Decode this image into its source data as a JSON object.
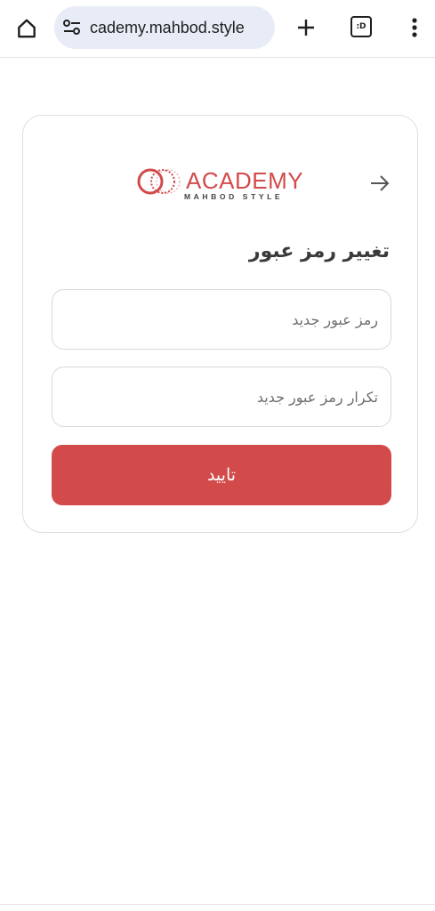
{
  "browser": {
    "url": "academy.mahbod.style",
    "url_visible": "cademy.mahbod.style",
    "tab_count_label": ":D"
  },
  "logo": {
    "main": "ACADEMY",
    "sub": "MAHBOD STYLE"
  },
  "form": {
    "title": "تغییر رمز عبور",
    "new_password_placeholder": "رمز عبور جدید",
    "repeat_password_placeholder": "تکرار رمز عبور جدید",
    "submit_label": "تایید"
  },
  "colors": {
    "accent": "#d24a4a",
    "url_bar": "#e7ecf7",
    "card_border": "#dedede"
  },
  "icons": {
    "home": "home-icon",
    "site_info": "tune-icon",
    "new_tab": "plus-icon",
    "tabs": "tab-switcher-icon",
    "menu": "more-vert-icon",
    "back": "arrow-right-icon"
  }
}
